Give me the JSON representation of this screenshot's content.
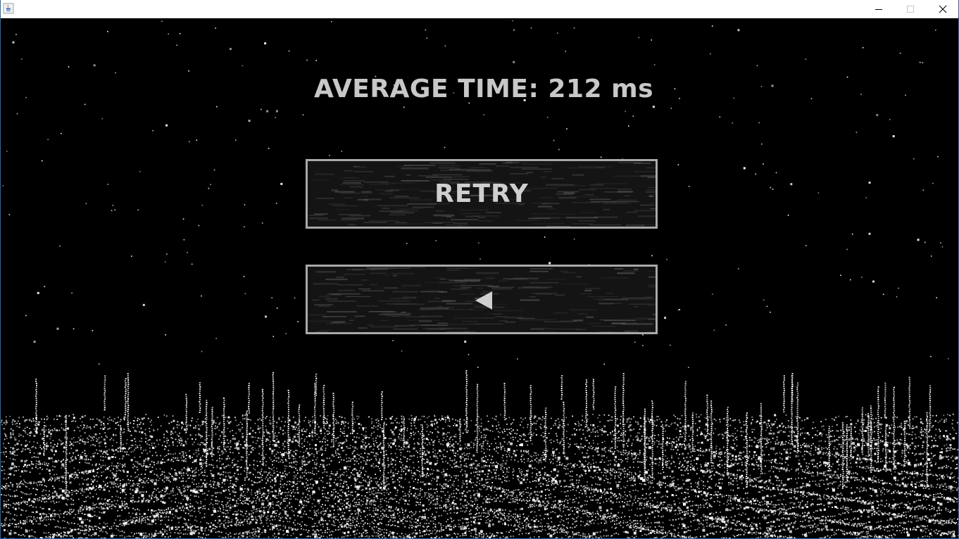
{
  "window": {
    "title": "",
    "icon": "java-cup-icon",
    "controls": [
      "minimize",
      "maximize",
      "close"
    ]
  },
  "result": {
    "average_label": "AVERAGE TIME: 212 ms"
  },
  "menu": {
    "retry_label": "RETRY",
    "back_icon": "left-triangle-icon"
  },
  "colors": {
    "background": "#000000",
    "text": "#c8c8c8",
    "button_border": "#a9a9a9",
    "button_fill": "#141414",
    "points": "#ffffff"
  }
}
